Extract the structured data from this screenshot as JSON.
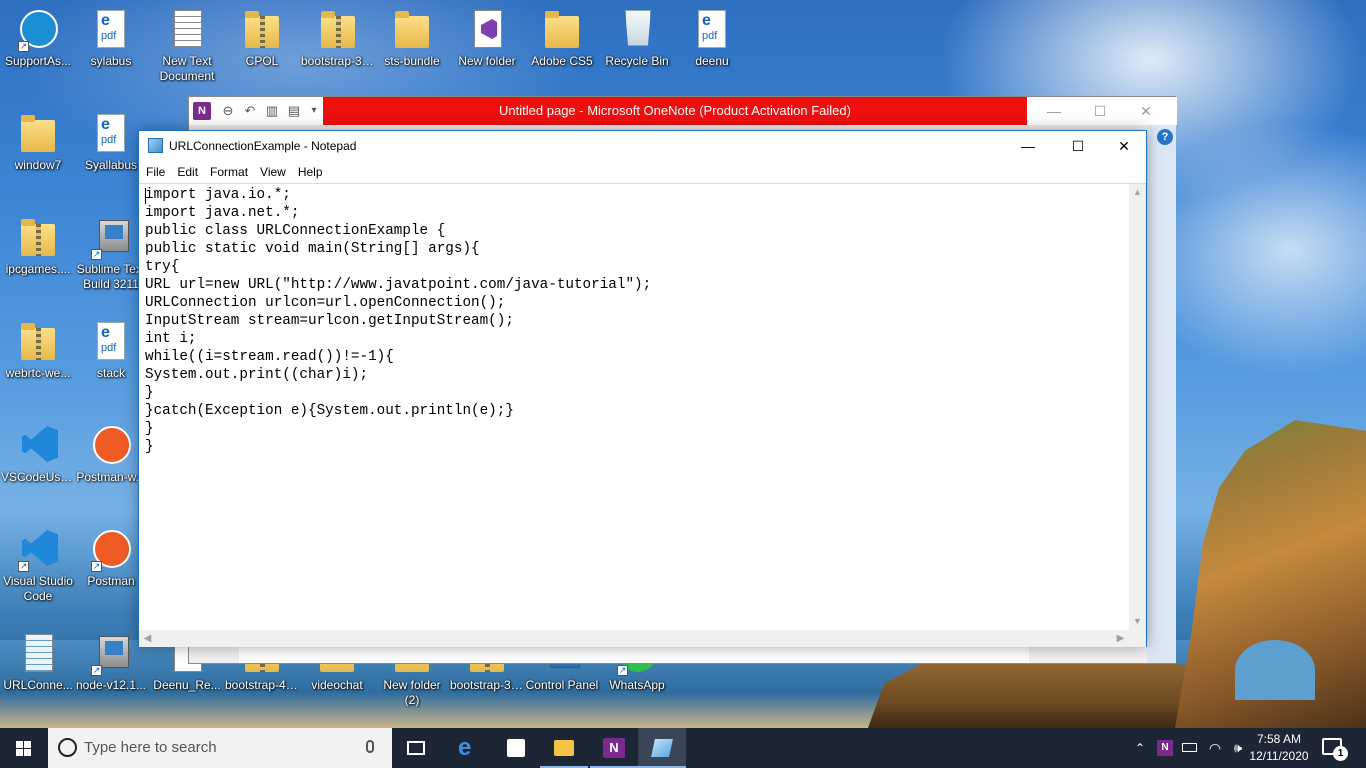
{
  "desktop": {
    "icons_top": [
      {
        "label": "SupportAs...",
        "icon": "support-assist-icon"
      },
      {
        "label": "sylabus",
        "icon": "pdf-file-icon"
      },
      {
        "label": "New Text Document",
        "icon": "text-file-icon"
      },
      {
        "label": "CPOL",
        "icon": "zip-folder-icon"
      },
      {
        "label": "bootstrap-3....",
        "icon": "zip-folder-icon"
      },
      {
        "label": "sts-bundle",
        "icon": "folder-icon"
      },
      {
        "label": "New folder",
        "icon": "visual-studio-project-icon"
      },
      {
        "label": "Adobe CS5",
        "icon": "folder-icon"
      },
      {
        "label": "Recycle Bin",
        "icon": "recycle-bin-icon"
      },
      {
        "label": "deenu",
        "icon": "pdf-file-icon"
      }
    ],
    "icons_left": [
      {
        "label": "window7",
        "icon": "folder-icon"
      },
      {
        "label": "Syallabus",
        "icon": "pdf-file-icon"
      },
      {
        "label": "ipcgames....",
        "icon": "zip-folder-icon"
      },
      {
        "label": "Sublime Text Build 3211",
        "icon": "installer-icon"
      },
      {
        "label": "webrtc-we...",
        "icon": "zip-folder-icon"
      },
      {
        "label": "stack",
        "icon": "pdf-file-icon"
      },
      {
        "label": "VSCodeUse...",
        "icon": "vscode-icon"
      },
      {
        "label": "Postman-w...",
        "icon": "postman-icon"
      },
      {
        "label": "Visual Studio Code",
        "icon": "vscode-icon"
      },
      {
        "label": "Postman",
        "icon": "postman-icon"
      }
    ],
    "icons_bottom": [
      {
        "label": "URLConne...",
        "icon": "notepad-file-icon"
      },
      {
        "label": "node-v12.1...",
        "icon": "installer-icon"
      },
      {
        "label": "Deenu_Re...",
        "icon": "word-file-icon"
      },
      {
        "label": "bootstrap-4....",
        "icon": "zip-folder-icon"
      },
      {
        "label": "videochat",
        "icon": "folder-icon"
      },
      {
        "label": "New folder (2)",
        "icon": "folder-icon"
      },
      {
        "label": "bootstrap-3....",
        "icon": "zip-folder-icon"
      },
      {
        "label": "Control Panel",
        "icon": "control-panel-icon"
      },
      {
        "label": "WhatsApp",
        "icon": "whatsapp-icon"
      }
    ]
  },
  "onenote": {
    "title": "Untitled page  -  Microsoft OneNote (Product Activation Failed)",
    "help": "?"
  },
  "notepad": {
    "title": "URLConnectionExample - Notepad",
    "menu": [
      "File",
      "Edit",
      "Format",
      "View",
      "Help"
    ],
    "controls": {
      "minimize": "—",
      "maximize": "☐",
      "close": "✕"
    },
    "code": "import java.io.*;\nimport java.net.*;\npublic class URLConnectionExample {\npublic static void main(String[] args){\ntry{\nURL url=new URL(\"http://www.javatpoint.com/java-tutorial\");\nURLConnection urlcon=url.openConnection();\nInputStream stream=urlcon.getInputStream();\nint i;\nwhile((i=stream.read())!=-1){\nSystem.out.print((char)i);\n}\n}catch(Exception e){System.out.println(e);}\n}\n}"
  },
  "taskbar": {
    "search_placeholder": "Type here to search",
    "time": "7:58 AM",
    "date": "12/11/2020",
    "notification_count": "1",
    "apps": [
      "task-view-icon",
      "edge-icon",
      "store-icon",
      "file-explorer-icon",
      "onenote-icon",
      "notepad-icon"
    ]
  },
  "colors": {
    "onenote_alert_bar": "#ee0f0f",
    "notepad_border": "#1a73c9",
    "taskbar": "#1c2635"
  }
}
